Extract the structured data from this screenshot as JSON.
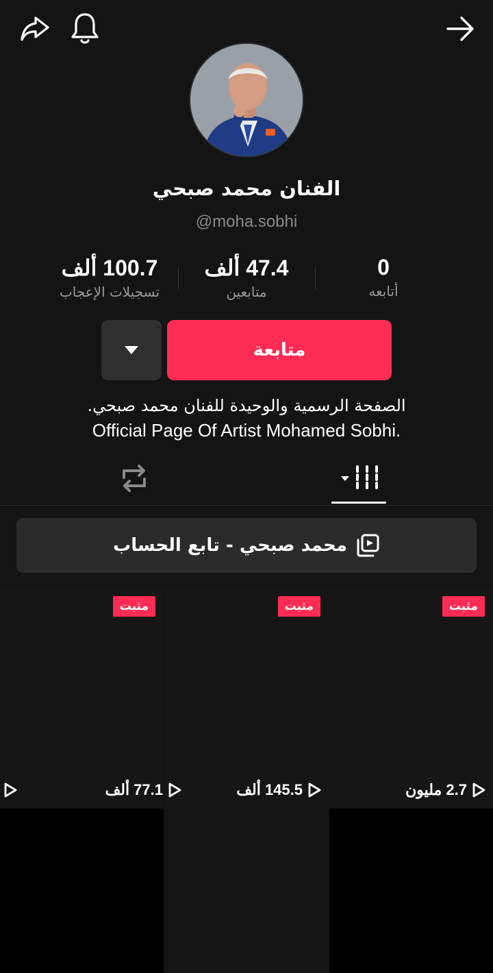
{
  "header": {
    "share_icon": "share-arrow-icon",
    "bell_icon": "bell-icon",
    "back_icon": "arrow-right-icon"
  },
  "profile": {
    "name": "الفنان محمد صبحي",
    "handle": "@moha.sobhi",
    "stats": [
      {
        "value": "100.7 ألف",
        "label": "تسجيلات الإعجاب"
      },
      {
        "value": "47.4 ألف",
        "label": "متابعين"
      },
      {
        "value": "0",
        "label": "أتابعه"
      }
    ],
    "follow_label": "متابعة",
    "bio_ar": "الصفحة الرسمية والوحيدة للفنان محمد صبحي.",
    "bio_en": "Official Page Of Artist Mohamed Sobhi."
  },
  "tabs": {
    "videos_icon": "grid-bars-icon",
    "reposts_icon": "repost-icon"
  },
  "playlist": {
    "label": "محمد صبحي - تابع الحساب",
    "icon": "playlist-icon"
  },
  "videos": [
    {
      "pinned": "مثبت",
      "views": "2.7 مليون"
    },
    {
      "pinned": "مثبت",
      "views": "145.5 ألف"
    },
    {
      "pinned": "مثبت",
      "views": "77.1 ألف"
    }
  ],
  "colors": {
    "background": "#141414",
    "accent": "#fe2c55",
    "secondary_button": "#2f2f2f",
    "muted_text": "#8a8a8a"
  }
}
